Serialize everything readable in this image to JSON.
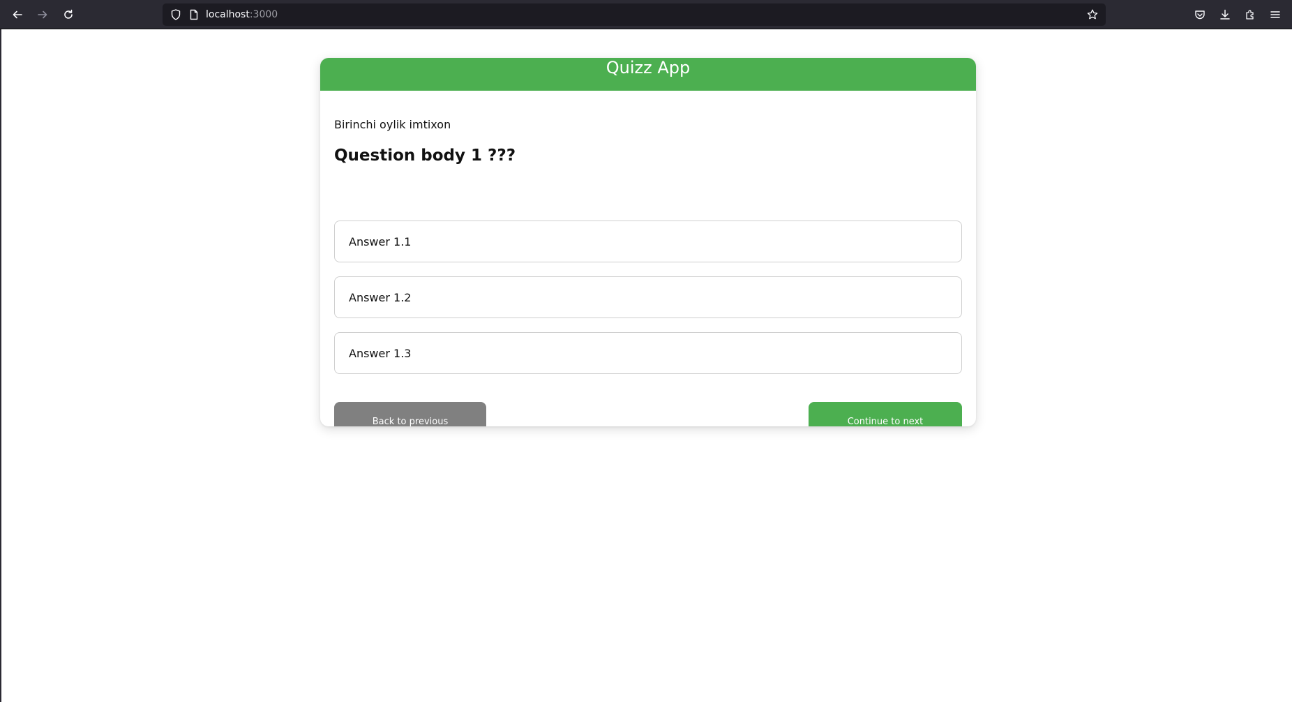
{
  "browser": {
    "url_host": "localhost",
    "url_port": ":3000"
  },
  "app": {
    "title": "Quizz App"
  },
  "quiz": {
    "exam_name": "Birinchi oylik imtixon",
    "question": "Question body 1 ???",
    "answers": [
      {
        "label": "Answer 1.1"
      },
      {
        "label": "Answer 1.2"
      },
      {
        "label": "Answer 1.3"
      }
    ]
  },
  "actions": {
    "back_label": "Back to previous",
    "next_label": "Continue to next"
  },
  "colors": {
    "accent": "#4caf50",
    "secondary": "#808080",
    "chrome_bg": "#2b2a33"
  },
  "icons": {
    "back": "arrow-left-icon",
    "forward": "arrow-right-icon",
    "reload": "reload-icon",
    "shield": "shield-icon",
    "page": "page-icon",
    "bookmark": "star-icon",
    "pocket": "pocket-icon",
    "download": "download-icon",
    "extensions": "extensions-icon",
    "menu": "hamburger-menu-icon"
  }
}
